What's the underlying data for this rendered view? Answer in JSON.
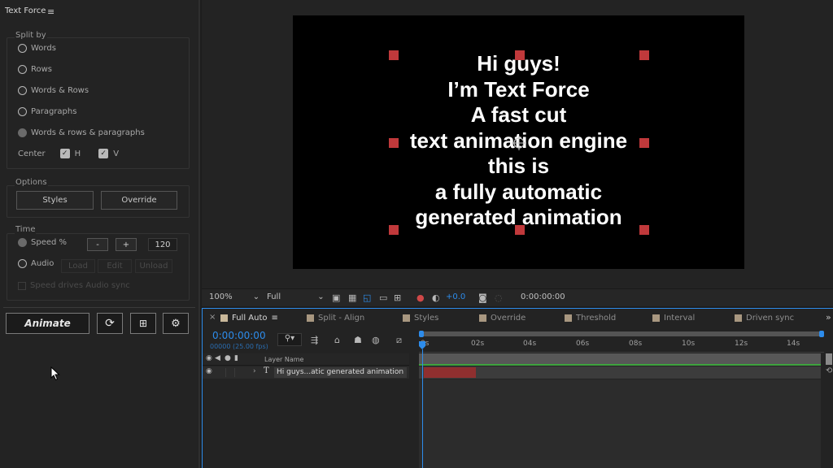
{
  "panel": {
    "title": "Text Force",
    "split_by": {
      "label": "Split by",
      "options": [
        "Words",
        "Rows",
        "Words & Rows",
        "Paragraphs",
        "Words & rows & paragraphs"
      ],
      "selected": "Words & rows & paragraphs",
      "center_label": "Center",
      "center_h": "H",
      "center_v": "V"
    },
    "options": {
      "label": "Options",
      "styles": "Styles",
      "override": "Override"
    },
    "time": {
      "label": "Time",
      "speed_label": "Speed %",
      "minus": "-",
      "plus": "+",
      "speed_value": "120",
      "audio_label": "Audio",
      "load": "Load",
      "edit": "Edit",
      "unload": "Unload",
      "speed_drives": "Speed drives Audio sync"
    },
    "animate": "Animate"
  },
  "viewer": {
    "text_lines": [
      "Hi guys!",
      "I’m Text Force",
      "A fast cut",
      "text animation engine",
      "this is",
      "a fully automatic",
      "generated animation"
    ],
    "handle_color": "#c0393b"
  },
  "viewer_toolbar": {
    "zoom": "100%",
    "quality": "Full",
    "exposure": "+0.0",
    "timecode": "0:00:00:00"
  },
  "timeline": {
    "tabs": [
      "Full Auto",
      "Split - Align",
      "Styles",
      "Override",
      "Threshold",
      "Interval",
      "Driven sync"
    ],
    "active_tab": "Full Auto",
    "current_time": "0:00:00:00",
    "frame_info": "00000 (25.00 fps)",
    "layer_name_header": "Layer Name",
    "layer_name": "Hi guys...atic generated animation",
    "layer_type": "T",
    "ruler": [
      "0s",
      "02s",
      "04s",
      "06s",
      "08s",
      "10s",
      "12s",
      "14s"
    ],
    "accent": "#2d8ceb",
    "bar_color": "#c0393b"
  }
}
